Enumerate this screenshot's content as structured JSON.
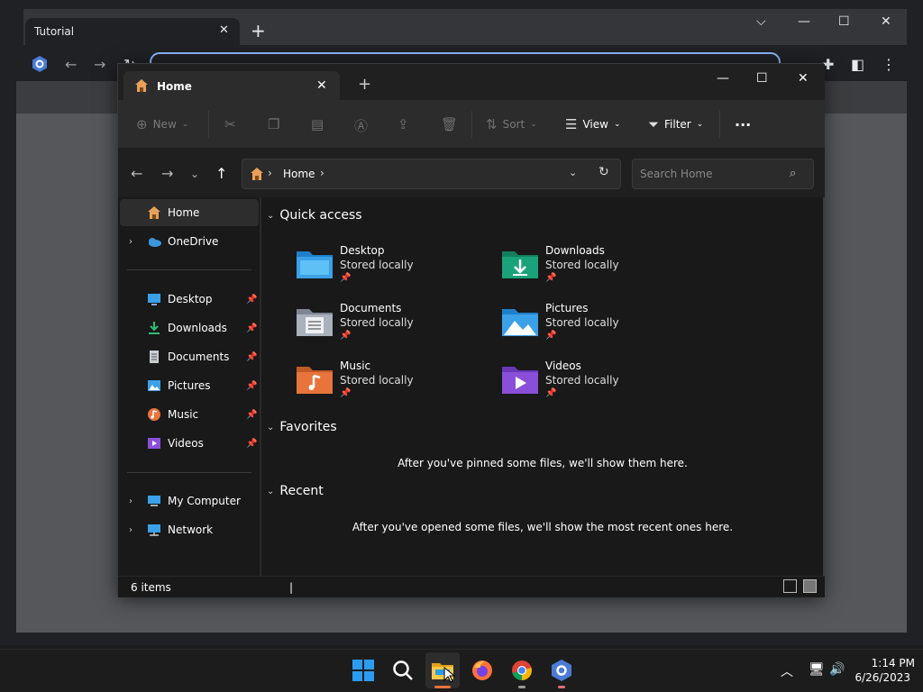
{
  "browser": {
    "tab_title": "Tutorial",
    "tab_close": "✕",
    "new_tab": "+"
  },
  "explorer": {
    "tab_title": "Home",
    "tab_close": "✕",
    "new_tab": "+",
    "toolbar": {
      "new_label": "New",
      "sort_label": "Sort",
      "view_label": "View",
      "filter_label": "Filter",
      "more_label": "···"
    },
    "address": {
      "path": "Home",
      "search_placeholder": "Search Home"
    },
    "sidebar": {
      "home": "Home",
      "onedrive": "OneDrive",
      "pinned": [
        {
          "label": "Desktop",
          "icon": "desktop-icon"
        },
        {
          "label": "Downloads",
          "icon": "downloads-icon"
        },
        {
          "label": "Documents",
          "icon": "documents-icon"
        },
        {
          "label": "Pictures",
          "icon": "pictures-icon"
        },
        {
          "label": "Music",
          "icon": "music-icon"
        },
        {
          "label": "Videos",
          "icon": "videos-icon"
        }
      ],
      "my_computer": "My Computer",
      "network": "Network"
    },
    "main": {
      "quick_access_title": "Quick access",
      "quick_access": [
        {
          "name": "Desktop",
          "sub": "Stored locally"
        },
        {
          "name": "Downloads",
          "sub": "Stored locally"
        },
        {
          "name": "Documents",
          "sub": "Stored locally"
        },
        {
          "name": "Pictures",
          "sub": "Stored locally"
        },
        {
          "name": "Music",
          "sub": "Stored locally"
        },
        {
          "name": "Videos",
          "sub": "Stored locally"
        }
      ],
      "favorites_title": "Favorites",
      "favorites_empty": "After you've pinned some files, we'll show them here.",
      "recent_title": "Recent",
      "recent_empty": "After you've opened some files, we'll show the most recent ones here."
    },
    "status": {
      "items": "6 items",
      "cursor": "|"
    }
  },
  "taskbar": {
    "time": "1:14 PM",
    "date": "6/26/2023"
  },
  "colors": {
    "folder_blue": "#3aa0e8",
    "downloads_green": "#1aa37a",
    "accent_orange": "#e8743b",
    "omnibox_blue": "#8ab4f8"
  }
}
